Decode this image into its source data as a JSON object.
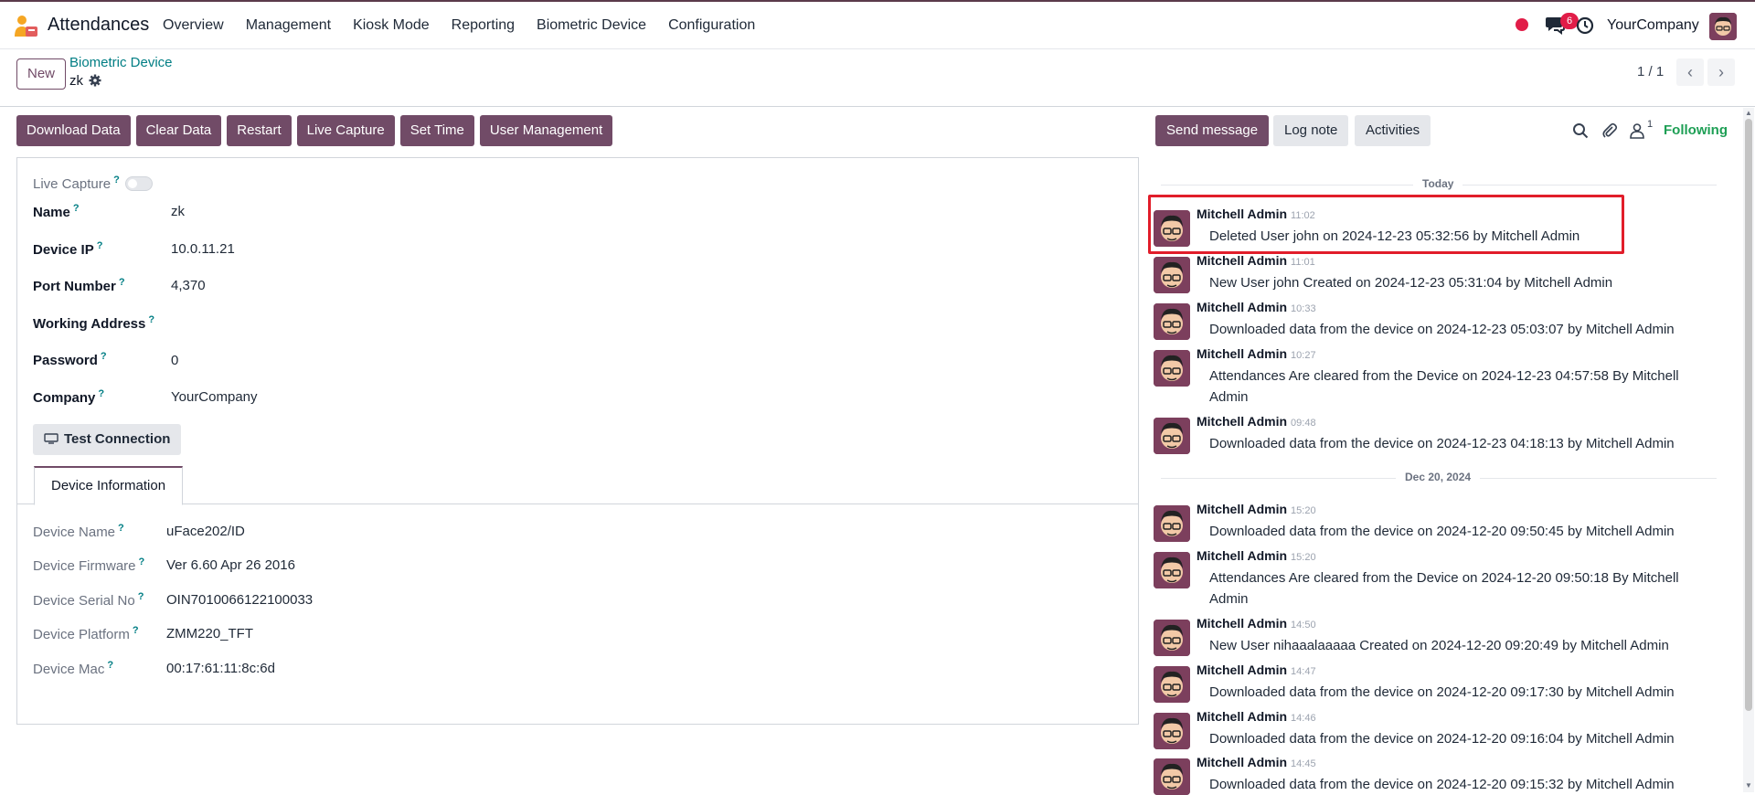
{
  "app": {
    "title": "Attendances"
  },
  "menu": [
    "Overview",
    "Management",
    "Kiosk Mode",
    "Reporting",
    "Biometric Device",
    "Configuration"
  ],
  "navbar": {
    "chat_count": "6",
    "company": "YourCompany"
  },
  "control": {
    "new_label": "New",
    "breadcrumb": "Biometric Device",
    "record": "zk",
    "pager": "1 / 1"
  },
  "actions": [
    "Download Data",
    "Clear Data",
    "Restart",
    "Live Capture",
    "Set Time",
    "User Management"
  ],
  "form": {
    "live_capture_label": "Live Capture",
    "fields": [
      {
        "label": "Name",
        "value": "zk"
      },
      {
        "label": "Device IP",
        "value": "10.0.11.21"
      },
      {
        "label": "Port Number",
        "value": "4,370"
      },
      {
        "label": "Working Address",
        "value": ""
      },
      {
        "label": "Password",
        "value": "0"
      },
      {
        "label": "Company",
        "value": "YourCompany"
      }
    ],
    "test_connection": "Test Connection",
    "tab": "Device Information",
    "info": [
      {
        "label": "Device Name",
        "value": "uFace202/ID"
      },
      {
        "label": "Device Firmware",
        "value": "Ver 6.60 Apr 26 2016"
      },
      {
        "label": "Device Serial No",
        "value": "OIN7010066122100033"
      },
      {
        "label": "Device Platform",
        "value": "ZMM220_TFT"
      },
      {
        "label": "Device Mac",
        "value": "00:17:61:11:8c:6d"
      }
    ]
  },
  "chatter": {
    "send_message": "Send message",
    "log_note": "Log note",
    "activities": "Activities",
    "followers_count": "1",
    "following": "Following",
    "date_today": "Today",
    "date_dec20": "Dec 20, 2024",
    "messages": [
      {
        "author": "Mitchell Admin",
        "time": "11:02",
        "body": "Deleted User john on 2024-12-23 05:32:56 by Mitchell Admin"
      },
      {
        "author": "Mitchell Admin",
        "time": "11:01",
        "body": "New User john Created on 2024-12-23 05:31:04 by Mitchell Admin"
      },
      {
        "author": "Mitchell Admin",
        "time": "10:33",
        "body": "Downloaded data from the device on 2024-12-23 05:03:07 by Mitchell Admin"
      },
      {
        "author": "Mitchell Admin",
        "time": "10:27",
        "body": "Attendances Are cleared from the Device on 2024-12-23 04:57:58 By Mitchell Admin"
      },
      {
        "author": "Mitchell Admin",
        "time": "09:48",
        "body": "Downloaded data from the device on 2024-12-23 04:18:13 by Mitchell Admin"
      },
      {
        "author": "Mitchell Admin",
        "time": "15:20",
        "body": "Downloaded data from the device on 2024-12-20 09:50:45 by Mitchell Admin"
      },
      {
        "author": "Mitchell Admin",
        "time": "15:20",
        "body": "Attendances Are cleared from the Device on 2024-12-20 09:50:18 By Mitchell Admin"
      },
      {
        "author": "Mitchell Admin",
        "time": "14:50",
        "body": "New User nihaaalaaaaa Created on 2024-12-20 09:20:49 by Mitchell Admin"
      },
      {
        "author": "Mitchell Admin",
        "time": "14:47",
        "body": "Downloaded data from the device on 2024-12-20 09:17:30 by Mitchell Admin"
      },
      {
        "author": "Mitchell Admin",
        "time": "14:46",
        "body": "Downloaded data from the device on 2024-12-20 09:16:04 by Mitchell Admin"
      },
      {
        "author": "Mitchell Admin",
        "time": "14:45",
        "body": "Downloaded data from the device on 2024-12-20 09:15:32 by Mitchell Admin"
      }
    ]
  }
}
